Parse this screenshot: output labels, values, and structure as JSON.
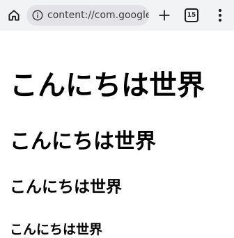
{
  "browser": {
    "url": "content://com.google.an",
    "tab_count": "15",
    "icons": {
      "home": "home-icon",
      "info": "info-icon",
      "new_tab": "plus-icon",
      "menu": "more-vertical-icon"
    }
  },
  "page": {
    "heading1": "こんにちは世界",
    "heading2": "こんにちは世界",
    "heading3": "こんにちは世界",
    "heading4": "こんにちは世界"
  }
}
